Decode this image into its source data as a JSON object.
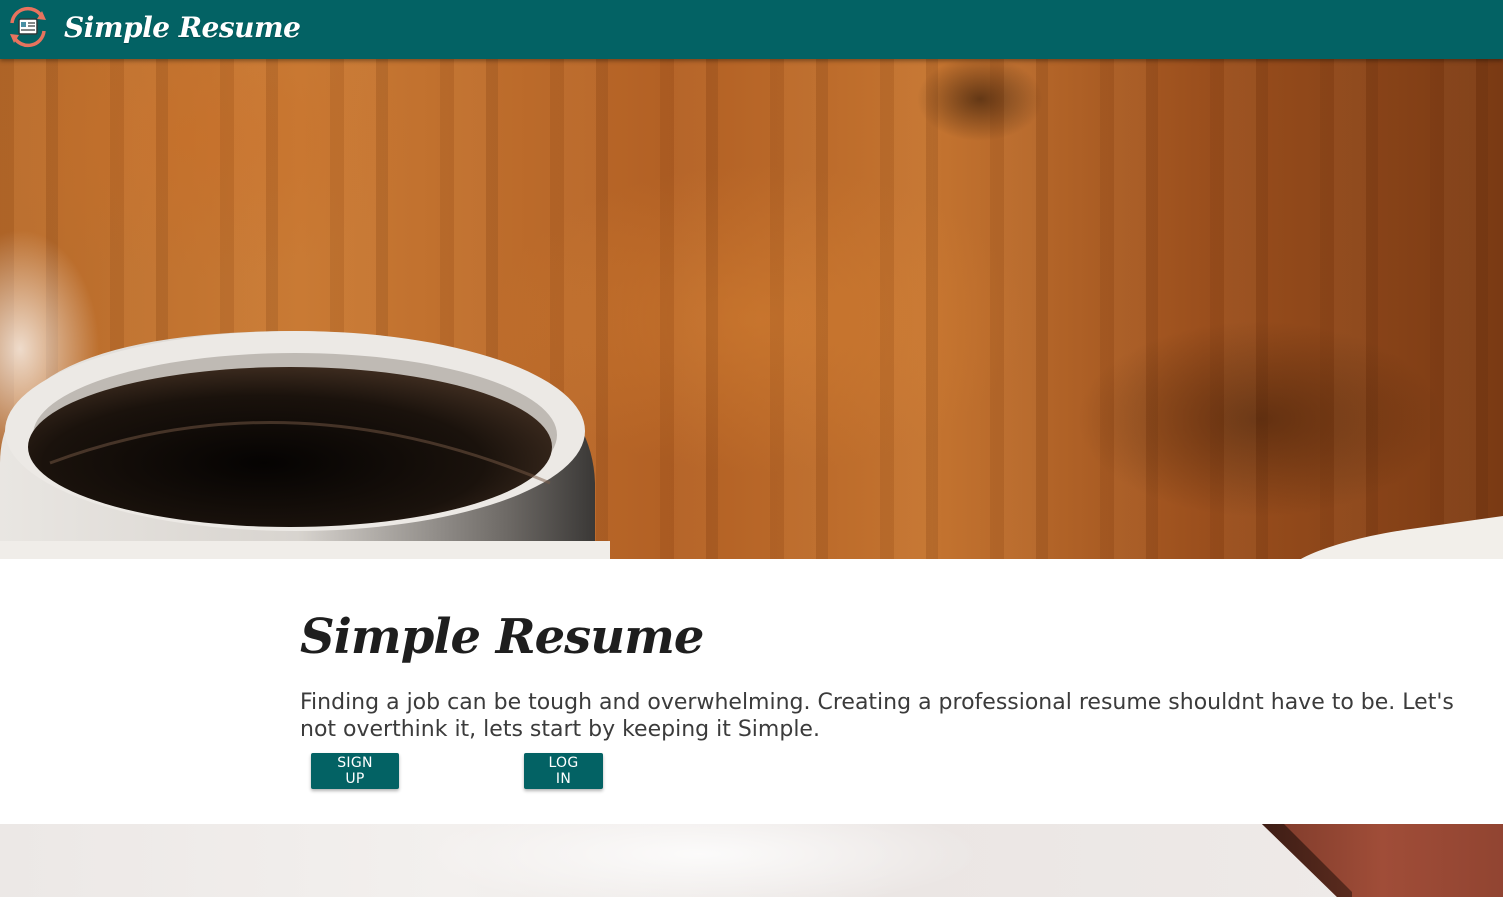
{
  "navbar": {
    "brand_title": "Simple Resume",
    "logo_icon": "resume-cycle-logo-icon",
    "background_color": "#036264"
  },
  "hero": {
    "image_description_icon": "coffee-mug-hero-image"
  },
  "main": {
    "heading": "Simple Resume",
    "tagline": "Finding a job can be tough and overwhelming. Creating a professional resume shouldnt have to be. Let's not overthink it, lets start by keeping it Simple.",
    "signup_label": "SIGN UP",
    "login_label": "LOG IN",
    "button_color": "#036264"
  }
}
